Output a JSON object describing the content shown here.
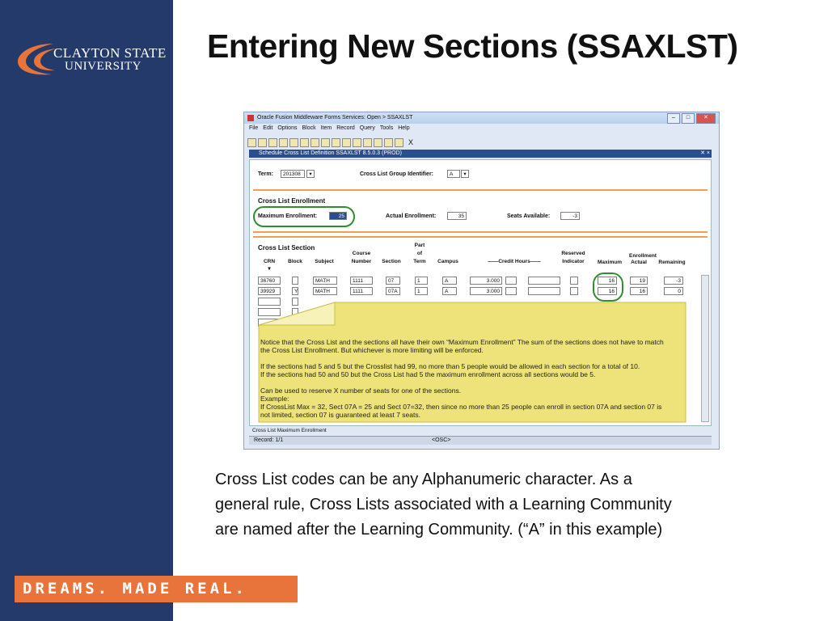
{
  "logo": {
    "line1": "CLAYTON STATE",
    "line2": "UNIVERSITY"
  },
  "tagline": "DREAMS. MADE REAL.",
  "title": "Entering New Sections (SSAXLST)",
  "body_lines": [
    "Cross List codes can be any Alphanumeric character. As a",
    "general rule, Cross Lists associated with a Learning Community",
    "are named after the Learning Community.  (“A” in this example)"
  ],
  "window": {
    "title": "Oracle Fusion Middleware Forms Services:  Open > SSAXLST",
    "menu": [
      "File",
      "Edit",
      "Options",
      "Block",
      "Item",
      "Record",
      "Query",
      "Tools",
      "Help"
    ],
    "toolbar_x": "X",
    "form_title": "Schedule Cross List Definition  SSAXLST  8.5.0.3  (PROD)",
    "form_close": "✕ ×",
    "term_label": "Term:",
    "term_value": "201308",
    "group_label": "Cross List Group Identifier:",
    "group_value": "A",
    "enroll_section": "Cross List Enrollment",
    "max_label": "Maximum Enrollment:",
    "max_value": "25",
    "actual_label": "Actual Enrollment:",
    "actual_value": "35",
    "seats_label": "Seats Available:",
    "seats_value": "-3",
    "section_title": "Cross List Section",
    "headers": {
      "crn": "CRN",
      "block": "Block",
      "subject": "Subject",
      "course": "Course",
      "number": "Number",
      "section": "Section",
      "part": "Part",
      "of": "of",
      "term": "Term",
      "campus": "Campus",
      "credit": "——Credit Hours——",
      "reserved": "Reserved",
      "indicator": "Indicator",
      "enrollment": "Enrollment",
      "maximum": "Maximum",
      "actual": "Actual",
      "remaining": "Remaining"
    },
    "rows": [
      {
        "crn": "36760",
        "block": "",
        "subject": "MATH",
        "number": "1111",
        "section": "07",
        "part": "1",
        "campus": "A",
        "credit": "3.000",
        "maximum": "16",
        "actual": "19",
        "remaining": "-3"
      },
      {
        "crn": "39929",
        "block": "Y",
        "subject": "MATH",
        "number": "1111",
        "section": "07A",
        "part": "1",
        "campus": "A",
        "credit": "3.000",
        "maximum": "16",
        "actual": "16",
        "remaining": "0"
      }
    ],
    "status1": "Cross List Maximum Enrollment",
    "status_record": "Record: 1/1",
    "status_osc": "<OSC>"
  },
  "note_lines": [
    "Notice that the Cross List and the sections all have their own “Maximum Enrollment” The sum of the sections does not have to match",
    "the Cross List Enrollment. But whichever is more limiting will be enforced.",
    "",
    "If the sections had 5 and 5 but the Crosslist had 99, no more than 5 people would be allowed in each section for a total of 10.",
    "If the sections had 50 and 50 but the Cross List had 5 the maximum enrollment across all sections would be 5.",
    "",
    "Can be used to reserve X number of seats for one of the sections.",
    "Example:",
    "If CrossList Max = 32, Sect 07A = 25 and Sect 07=32, then since no more than 25 people can enroll in section 07A and section 07 is",
    "not limited, section 07 is guaranteed at least 7 seats."
  ],
  "colors": {
    "sidebar": "#243a6b",
    "tagline": "#e8743b",
    "note": "#ede37a",
    "circle": "#2f8f2f"
  }
}
